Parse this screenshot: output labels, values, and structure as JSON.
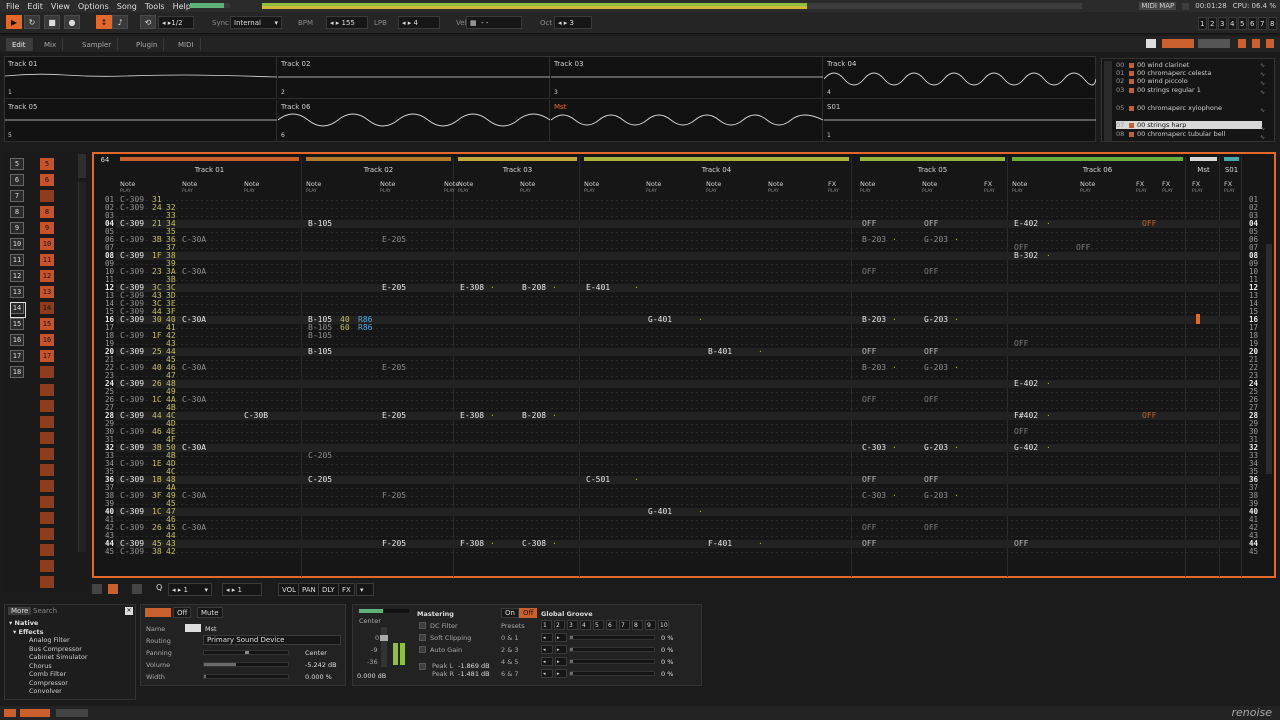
{
  "menu": [
    "File",
    "Edit",
    "View",
    "Options",
    "Song",
    "Tools",
    "Help"
  ],
  "status": {
    "midi": "MIDI MAP",
    "time": "00:01:28",
    "cpu": "CPU: 06.4 %"
  },
  "transport": {
    "pattern_counter": "1/2",
    "sync_label": "Sync",
    "sync_value": "Internal",
    "bpm_label": "BPM",
    "bpm_value": "155",
    "lpb_label": "LPB",
    "lpb_value": "4",
    "vel_label": "Vel",
    "vel_value": "- -",
    "oct_label": "Oct",
    "oct_value": "3",
    "track_buttons": [
      "1",
      "2",
      "3",
      "4",
      "5",
      "6",
      "7",
      "8"
    ]
  },
  "tabs": [
    "Edit",
    "Mix",
    "Sampler",
    "Plugin",
    "MIDI"
  ],
  "scopes": [
    {
      "title": "Track 01",
      "num": "1"
    },
    {
      "title": "Track 02",
      "num": "2"
    },
    {
      "title": "Track 03",
      "num": "3"
    },
    {
      "title": "Track 04",
      "num": "4"
    },
    {
      "title": "Track 05",
      "num": "5"
    },
    {
      "title": "Track 06",
      "num": "6"
    },
    {
      "title": "Mst",
      "num": ""
    },
    {
      "title": "S01",
      "num": "1"
    }
  ],
  "instruments": [
    {
      "no": "00",
      "name": "00 wind clarinet"
    },
    {
      "no": "01",
      "name": "00 chromaperc celesta"
    },
    {
      "no": "02",
      "name": "00 wind piccolo"
    },
    {
      "no": "03",
      "name": "00 strings regular 1"
    },
    {
      "no": "05",
      "name": "00 chromaperc xylophone"
    },
    {
      "no": "07",
      "name": "00 strings harp"
    },
    {
      "no": "08",
      "name": "00 chromaperc tubular bell"
    }
  ],
  "sequence": {
    "rows": [
      "5",
      "6",
      "7",
      "8",
      "9",
      "10",
      "11",
      "12",
      "13",
      "14",
      "15",
      "16",
      "17",
      "18"
    ],
    "cells": [
      "5",
      "6",
      "",
      "8",
      "9",
      "10",
      "11",
      "12",
      "13",
      "14",
      "15",
      "16",
      "17",
      ""
    ]
  },
  "editor": {
    "lines": "64",
    "tracks": [
      {
        "name": "Track 01",
        "color": "#c8602e",
        "cols": [
          "Note",
          "Note",
          "Note"
        ]
      },
      {
        "name": "Track 02",
        "color": "#b07a2a",
        "cols": [
          "Note",
          "Note",
          "Note"
        ]
      },
      {
        "name": "Track 03",
        "color": "#c0a83a",
        "cols": [
          "Note",
          "Note"
        ]
      },
      {
        "name": "Track 04",
        "color": "#a8b43c",
        "cols": [
          "Note",
          "Note",
          "Note",
          "Note",
          "FX"
        ]
      },
      {
        "name": "Track 05",
        "color": "#96b440",
        "cols": [
          "Note",
          "Note",
          "FX"
        ]
      },
      {
        "name": "Track 06",
        "color": "#6cac3c",
        "cols": [
          "Note",
          "Note",
          "FX",
          "FX"
        ]
      },
      {
        "name": "Mst",
        "color": "#d8d8d8",
        "cols": [
          "FX"
        ]
      },
      {
        "name": "S01",
        "color": "#4aa8a8",
        "cols": [
          "FX"
        ]
      }
    ],
    "play": "PLAY",
    "rows": [
      "01",
      "02",
      "03",
      "04",
      "05",
      "06",
      "07",
      "08",
      "09",
      "10",
      "11",
      "12",
      "13",
      "14",
      "15",
      "16",
      "17",
      "18",
      "19",
      "20",
      "21",
      "22",
      "23",
      "24",
      "25",
      "26",
      "27",
      "28",
      "29",
      "30",
      "31",
      "32",
      "33",
      "34",
      "35",
      "36",
      "37",
      "38",
      "39",
      "40",
      "41",
      "42",
      "43",
      "44",
      "45"
    ],
    "t1": [
      [
        "C-309",
        "31",
        ""
      ],
      [
        "C-309",
        "24",
        "32"
      ],
      [
        "",
        "",
        "33"
      ],
      [
        "C-309",
        "21",
        "34"
      ],
      [
        "",
        "",
        "35"
      ],
      [
        "C-309",
        "3B",
        "36"
      ],
      [
        "",
        "",
        "37"
      ],
      [
        "C-309",
        "1F",
        "38"
      ],
      [
        "",
        "",
        "39"
      ],
      [
        "C-309",
        "23",
        "3A"
      ],
      [
        "",
        "",
        "3B"
      ],
      [
        "C-309",
        "3C",
        "3C"
      ],
      [
        "C-309",
        "43",
        "3D"
      ],
      [
        "C-309",
        "3C",
        "3E"
      ],
      [
        "C-309",
        "44",
        "3F"
      ],
      [
        "C-309",
        "30",
        "40"
      ],
      [
        "",
        "",
        "41"
      ],
      [
        "C-309",
        "1F",
        "42"
      ],
      [
        "",
        "",
        "43"
      ],
      [
        "C-309",
        "25",
        "44"
      ],
      [
        "",
        "",
        "45"
      ],
      [
        "C-309",
        "40",
        "46"
      ],
      [
        "",
        "",
        "47"
      ],
      [
        "C-309",
        "26",
        "48"
      ],
      [
        "",
        "",
        "49"
      ],
      [
        "C-309",
        "1C",
        "4A"
      ],
      [
        "",
        "",
        "4B"
      ],
      [
        "C-309",
        "44",
        "4C"
      ],
      [
        "",
        "",
        "4D"
      ],
      [
        "C-309",
        "46",
        "4E"
      ],
      [
        "",
        "",
        "4F"
      ],
      [
        "C-309",
        "3B",
        "50"
      ],
      [
        "",
        "",
        "4B"
      ],
      [
        "C-309",
        "1E",
        "4D"
      ],
      [
        "",
        "",
        "4C"
      ],
      [
        "C-309",
        "1B",
        "48"
      ],
      [
        "",
        "",
        "4A"
      ],
      [
        "C-309",
        "3F",
        "49"
      ],
      [
        "",
        "",
        "45"
      ],
      [
        "C-309",
        "1C",
        "47"
      ],
      [
        "",
        "",
        "46"
      ],
      [
        "C-309",
        "26",
        "45"
      ],
      [
        "",
        "",
        "44"
      ],
      [
        "C-309",
        "45",
        "43"
      ],
      [
        "C-309",
        "38",
        "42"
      ]
    ],
    "t1b": {
      "5": "C-30A",
      "9": "C-30A",
      "15": "C-30A",
      "21": "C-30A",
      "25": "C-30A",
      "31": "C-30A",
      "37": "C-30A",
      "41": "C-30A"
    },
    "t1c": {
      "27": "C-30B"
    },
    "t2": {
      "3": "B-105",
      "15": "B-105",
      "16": "B-105",
      "17": "B-105",
      "19": "B-105",
      "32": "C-205",
      "35": "C-205"
    },
    "t2v": {
      "15": "40",
      "16": "60"
    },
    "t2fx": {
      "15": "R86",
      "16": "R86"
    },
    "t2b": {
      "5": "E-205",
      "11": "E-205",
      "21": "E-205",
      "27": "E-205",
      "37": "F-205",
      "43": "F-205"
    },
    "t3": {
      "11": "E-308",
      "27": "E-308",
      "43": "F-308"
    },
    "t3b": {
      "11": "B-208",
      "27": "B-208",
      "43": "C-308"
    },
    "t4": {
      "11": "E-401",
      "35": "C-501"
    },
    "t4b": {
      "15": "G-401",
      "39": "G-401"
    },
    "t4c": {
      "19": "B-401",
      "43": "F-401"
    },
    "t5": {
      "3": "OFF",
      "5": "B-203",
      "9": "OFF",
      "15": "B-203",
      "19": "OFF",
      "21": "B-203",
      "25": "OFF",
      "31": "C-303",
      "35": "OFF",
      "37": "C-303",
      "41": "OFF",
      "43": "OFF"
    },
    "t5b": {
      "3": "OFF",
      "5": "G-203",
      "9": "OFF",
      "15": "G-203",
      "19": "OFF",
      "21": "G-203",
      "25": "OFF",
      "31": "G-203",
      "35": "OFF",
      "37": "G-203",
      "41": "OFF"
    },
    "t6": {
      "3": "E-402",
      "6": "OFF",
      "7": "B-302",
      "18": "OFF",
      "23": "E-402",
      "27": "F#402",
      "29": "OFF",
      "31": "G-402",
      "43": "OFF"
    },
    "t6b": {
      "6": "OFF"
    },
    "t6fx": {
      "3": "OFF",
      "27": "OFF"
    }
  },
  "toolbar": {
    "step": "1",
    "edit_step": "1",
    "tags": [
      "VOL",
      "PAN",
      "DLY",
      "FX"
    ]
  },
  "browser": {
    "tabs": [
      "More",
      "Search"
    ],
    "tree": [
      "Native",
      "Effects"
    ],
    "items": [
      "Analog Filter",
      "Bus Compressor",
      "Cabinet Simulator",
      "Chorus",
      "Comb Filter",
      "Compressor",
      "Convolver"
    ]
  },
  "track_dsp": {
    "btn_off": "Off",
    "btn_mute": "Mute",
    "name_label": "Name",
    "name_value": "Mst",
    "routing_label": "Routing",
    "routing_value": "Primary Sound Device",
    "panning_label": "Panning",
    "panning_value": "Center",
    "volume_label": "Volume",
    "volume_value": "-5.242 dB",
    "width_label": "Width",
    "width_value": "0.000 %"
  },
  "master": {
    "meter_label": "Center",
    "meter_scale": [
      "0",
      "-9",
      "-36"
    ],
    "meter_db": "0.000 dB",
    "title": "Mastering",
    "options": [
      "DC Filter",
      "Soft Clipping",
      "Auto Gain"
    ],
    "peak_l_label": "Peak L",
    "peak_l": "-1.869 dB",
    "peak_r_label": "Peak R",
    "peak_r": "-1.481 dB",
    "groove_on": "On",
    "groove_off": "Off",
    "groove_title": "Global Groove",
    "presets_label": "Presets",
    "presets": [
      "1",
      "2",
      "3",
      "4",
      "5",
      "6",
      "7",
      "8",
      "9",
      "10"
    ],
    "groove_rows": [
      {
        "label": "0 & 1",
        "value": "0 %"
      },
      {
        "label": "2 & 3",
        "value": "0 %"
      },
      {
        "label": "4 & 5",
        "value": "0 %"
      },
      {
        "label": "6 & 7",
        "value": "0 %"
      }
    ]
  },
  "brand": "renoise"
}
